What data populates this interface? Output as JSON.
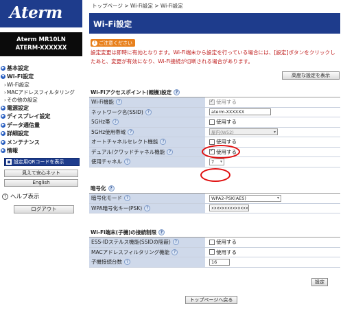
{
  "sidebar": {
    "logo": "Aterm",
    "model_line1": "Aterm   MR10LN",
    "model_line2": "ATERM-XXXXXX",
    "menu": [
      {
        "label": "基本設定"
      },
      {
        "label": "Wi-Fi設定"
      }
    ],
    "wifi_sub": [
      "Wi-Fi設定",
      "MACアドレスフィルタリング",
      "その他の設定"
    ],
    "menu2": [
      {
        "label": "電源設定"
      },
      {
        "label": "ディスプレイ設定"
      },
      {
        "label": "データ通信量"
      },
      {
        "label": "詳細設定"
      },
      {
        "label": "メンテナンス"
      },
      {
        "label": "情報"
      }
    ],
    "qr_button": "設定用QRコードを表示",
    "mieru_button": "見えて安心ネット",
    "english_button": "English",
    "help_label": "ヘルプ表示",
    "logout_button": "ログアウト"
  },
  "main": {
    "breadcrumb": {
      "top": "トップページ",
      "sep1": " > ",
      "wifi": "Wi-Fi設定",
      "sep2": " > ",
      "current": "Wi-Fi設定"
    },
    "title": "Wi-Fi設定",
    "notice_tag": "ご注意ください",
    "notice_text": "設定変更は即時に有効となります。Wi-Fi端末から設定を行っている場合には、[設定]ボタンをクリックしたあと、変更が有効になり、Wi-Fi接続が切断される場合があります。",
    "advanced_button": "高度な設定を表示",
    "ap_section": {
      "title": "Wi-Fiアクセスポイント(親機)設定",
      "wifi_func_label": "Wi-Fi機能",
      "wifi_func_value": "使用する",
      "ssid_label": "ネットワーク名(SSID)",
      "ssid_value": "aterm-XXXXXX",
      "band5_label": "5GHz帯",
      "band5_value": "使用する",
      "band5_range_label": "5GHz使用帯域",
      "band5_range_value": "屋内(W52)",
      "auto_channel_label": "オートチャネルセレクト機能",
      "auto_channel_value": "使用する",
      "dual_label": "デュアル/クワッドチャネル機能",
      "dual_value": "使用する",
      "channel_label": "使用チャネル",
      "channel_value": "7"
    },
    "enc_section": {
      "title": "暗号化",
      "mode_label": "暗号化モード",
      "mode_value": "WPA2-PSK(AES)",
      "key_label": "WPA暗号化キー(PSK)",
      "key_value": "xxxxxxxxxxxxxx"
    },
    "limit_section": {
      "title": "Wi-Fi端末(子機)の接続制限",
      "essid_label": "ESS-IDステルス機能(SSIDの隠蔽)",
      "essid_value": "使用する",
      "mac_label": "MACアドレスフィルタリング機能",
      "mac_value": "使用する",
      "count_label": "子機接続台数",
      "count_value": "16"
    },
    "save_button": "設定",
    "back_button": "トップページへ戻る"
  },
  "colors": {
    "brand_blue": "#1e3c8c",
    "notice_orange": "#e8801c",
    "notice_red": "#c02020",
    "label_bg": "#cfd9ea",
    "highlight_red": "#e01010"
  }
}
